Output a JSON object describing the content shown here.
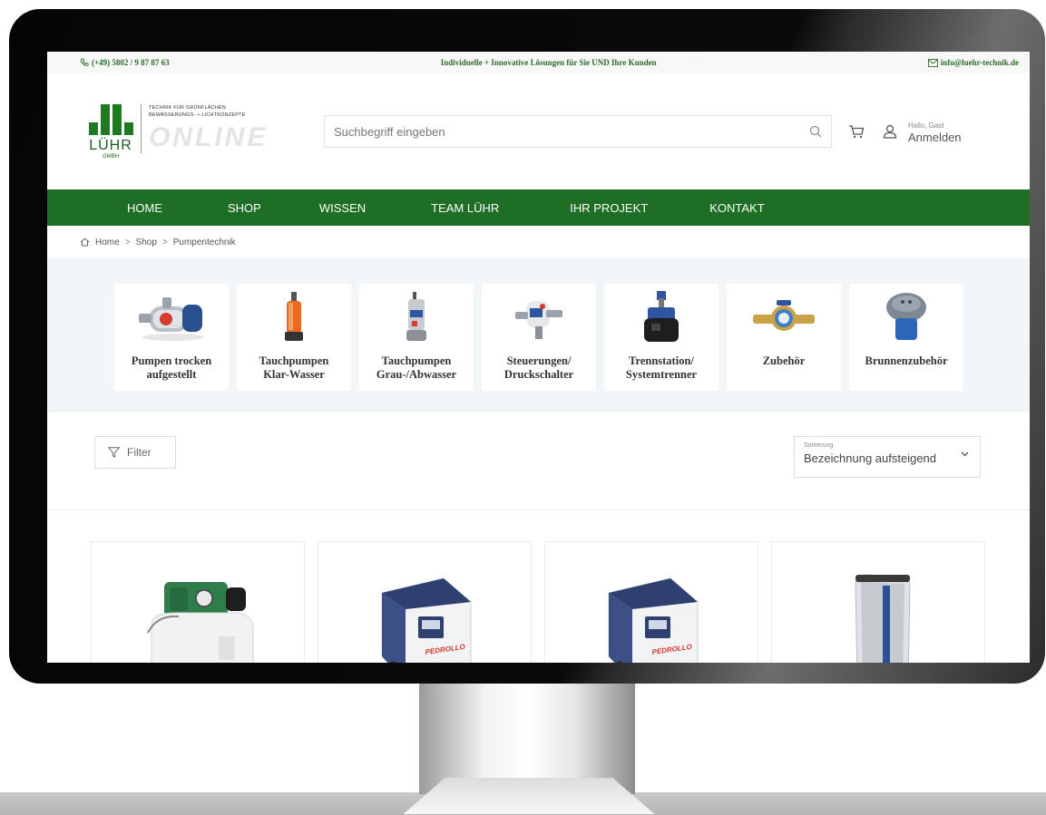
{
  "topbar": {
    "phone": "(+49) 5802 / 9 87 87 63",
    "slogan": "Individuelle + Innovative Lösungen für Sie UND Ihre Kunden",
    "email": "info@luehr-technik.de"
  },
  "logo": {
    "name": "LÜHR",
    "gmbh": "GMBH",
    "tagline_1": "TECHNIK FÜR GRÜNFLÄCHEN",
    "tagline_2": "BEWÄSSERUNGS- + LICHTKONZEPTE",
    "online": "ONLINE"
  },
  "search": {
    "placeholder": "Suchbegriff eingeben"
  },
  "account": {
    "greeting": "Hallo, Gast",
    "login": "Anmelden"
  },
  "nav": [
    "HOME",
    "SHOP",
    "WISSEN",
    "TEAM LÜHR",
    "IHR PROJEKT",
    "KONTAKT"
  ],
  "breadcrumb": [
    "Home",
    "Shop",
    "Pumpentechnik"
  ],
  "categories": [
    {
      "line1": "Pumpen trocken",
      "line2": "aufgestellt",
      "icon": "surface-pump-icon"
    },
    {
      "line1": "Tauchpumpen",
      "line2": "Klar-Wasser",
      "icon": "submersible-pump-orange-icon"
    },
    {
      "line1": "Tauchpumpen",
      "line2": "Grau-/Abwasser",
      "icon": "submersible-pump-steel-icon"
    },
    {
      "line1": "Steuerungen/",
      "line2": "Druckschalter",
      "icon": "pressure-switch-icon"
    },
    {
      "line1": "Trennstation/",
      "line2": "Systemtrenner",
      "icon": "separation-station-icon"
    },
    {
      "line1": "Zubehör",
      "line2": "",
      "icon": "water-meter-icon"
    },
    {
      "line1": "Brunnenzubehör",
      "line2": "",
      "icon": "well-cap-icon"
    }
  ],
  "filter": {
    "label": "Filter"
  },
  "sort": {
    "label": "Sortierung",
    "value": "Bezeichnung aufsteigend"
  },
  "brand_text": "PEDROLLO",
  "colors": {
    "brand_green": "#1f6e25",
    "text_green": "#2a6b2a"
  }
}
